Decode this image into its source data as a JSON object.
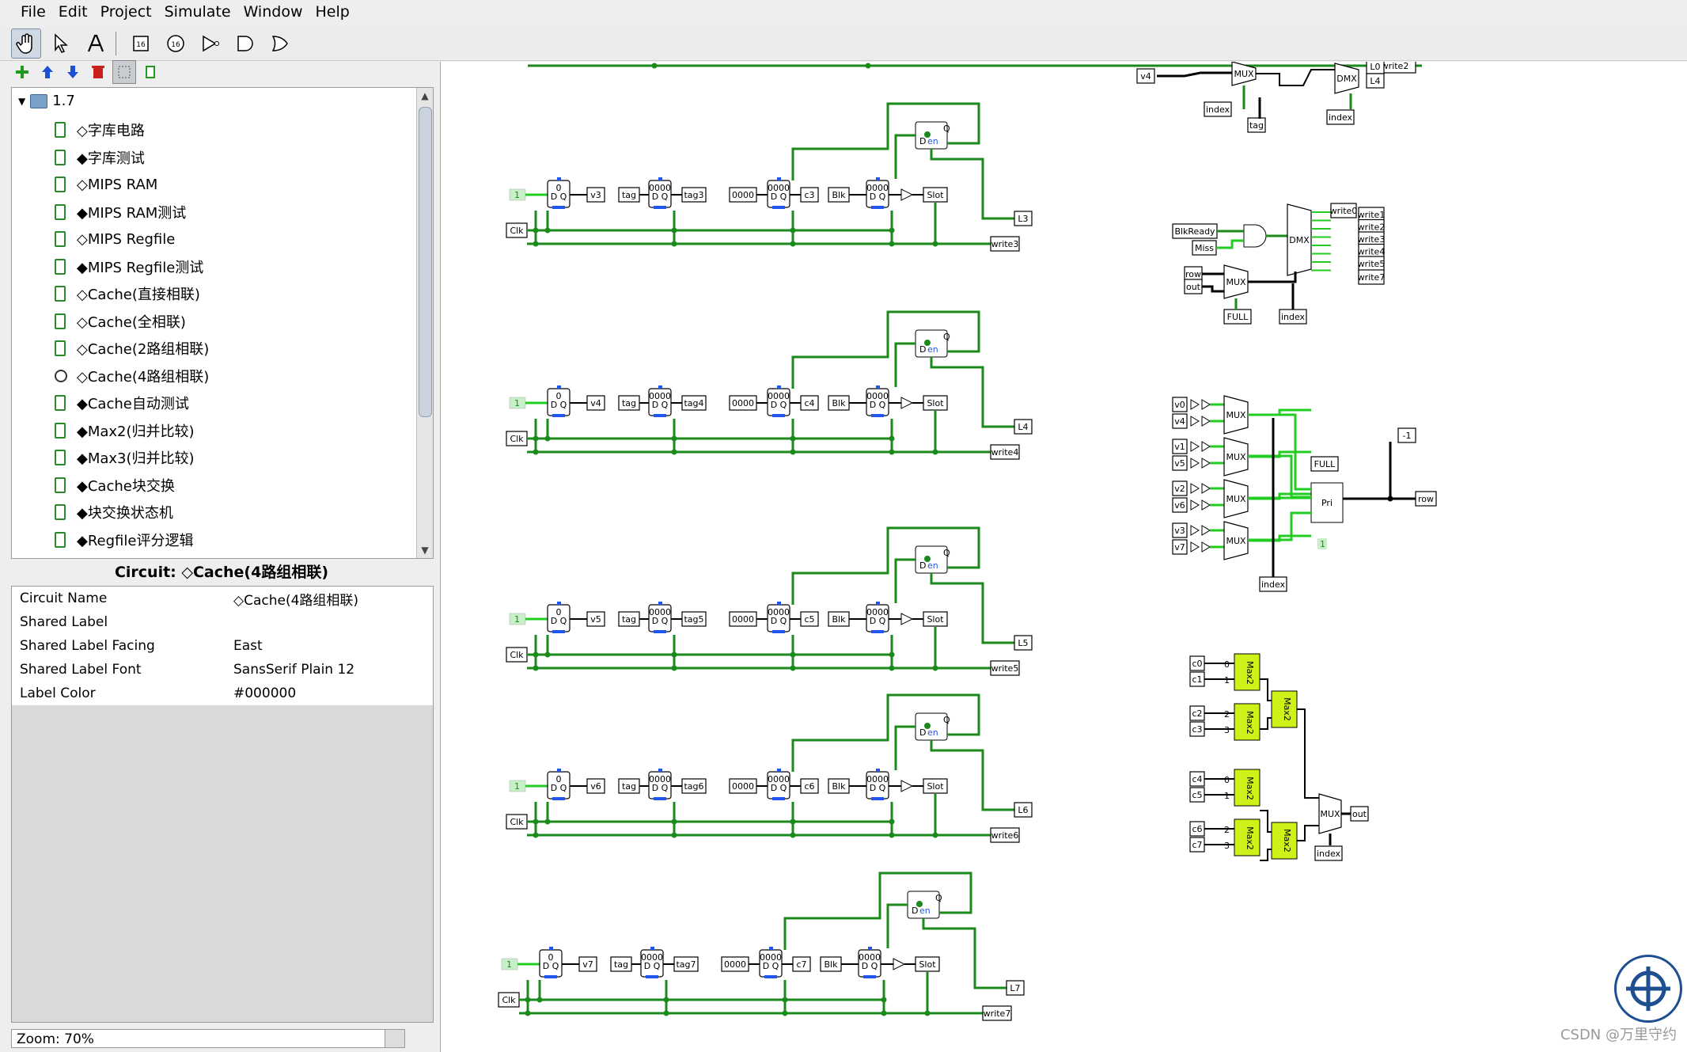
{
  "menubar": {
    "items": [
      "File",
      "Edit",
      "Project",
      "Simulate",
      "Window",
      "Help"
    ]
  },
  "toolbar": {
    "tools": [
      "hand-icon",
      "select-arrow-icon",
      "text-tool-icon",
      "input-pin-icon",
      "output-pin-icon",
      "not-gate-icon",
      "and-gate-icon",
      "or-gate-icon"
    ],
    "subtools": [
      "add-circuit-icon",
      "move-up-icon",
      "move-down-icon",
      "delete-icon",
      "layout-view-icon",
      "appearance-view-icon"
    ]
  },
  "tree": {
    "root": "1.7",
    "items": [
      "◇字库电路",
      "◆字库测试",
      "◇MIPS RAM",
      "◆MIPS RAM测试",
      "◇MIPS Regfile",
      "◆MIPS Regfile测试",
      "◇Cache(直接相联)",
      "◇Cache(全相联)",
      "◇Cache(2路组相联)",
      "◇Cache(4路组相联)",
      "◆Cache自动测试",
      "◆Max2(归并比较)",
      "◆Max3(归并比较)",
      "◆Cache块交换",
      "◆块交换状态机",
      "◆Regfile评分逻辑"
    ],
    "active_index": 9
  },
  "properties": {
    "title": "Circuit: ◇Cache(4路组相联)",
    "rows": [
      {
        "key": "Circuit Name",
        "value": "◇Cache(4路组相联)"
      },
      {
        "key": "Shared Label",
        "value": ""
      },
      {
        "key": "Shared Label Facing",
        "value": "East"
      },
      {
        "key": "Shared Label Font",
        "value": "SansSerif Plain 12"
      },
      {
        "key": "Label Color",
        "value": "#000000"
      }
    ]
  },
  "zoom": "Zoom: 70%",
  "watermark": "CSDN @万里守约",
  "circuit": {
    "rows": [
      {
        "v": "v3",
        "tag": "tag3",
        "c": "c3",
        "L": "L3",
        "write": "write3"
      },
      {
        "v": "v4",
        "tag": "tag4",
        "c": "c4",
        "L": "L4",
        "write": "write4"
      },
      {
        "v": "v5",
        "tag": "tag5",
        "c": "c5",
        "L": "L5",
        "write": "write5"
      },
      {
        "v": "v6",
        "tag": "tag6",
        "c": "c6",
        "L": "L6",
        "write": "write6"
      },
      {
        "v": "v7",
        "tag": "tag7",
        "c": "c7",
        "L": "L7",
        "write": "write7"
      }
    ],
    "common": {
      "clk": "Clk",
      "tagin": "tag",
      "zero": "0000",
      "blk": "Blk",
      "slot": "Slot",
      "one": "1",
      "dq": "D Q",
      "reg_val": "0000",
      "q": "Q",
      "d": "D",
      "en": "en"
    },
    "top": {
      "write": "write2",
      "v": "v4",
      "mux": "MUX",
      "dmx": "DMX",
      "index": "index",
      "tag": "tag",
      "L0": "L0",
      "L4": "L4"
    },
    "dmx_block": {
      "inputs": [
        "BlkReady",
        "Miss",
        "row",
        "out"
      ],
      "outputs": [
        "write0",
        "write1",
        "write2",
        "write3",
        "write4",
        "write5",
        "write6",
        "write7"
      ],
      "full": "FULL",
      "index": "index",
      "mux": "MUX",
      "dmx": "DMX"
    },
    "pri_block": {
      "v": [
        "v0",
        "v4",
        "v1",
        "v5",
        "v2",
        "v6",
        "v3",
        "v7"
      ],
      "mux": "MUX",
      "pri": "Pri",
      "full": "FULL",
      "row": "row",
      "index": "index",
      "neg": "-1",
      "one": "1"
    },
    "max_block": {
      "c": [
        "c0",
        "c1",
        "c2",
        "c3",
        "c4",
        "c5",
        "c6",
        "c7"
      ],
      "consts": [
        "0",
        "1",
        "2",
        "3",
        "0",
        "1",
        "2",
        "3"
      ],
      "max": "Max2",
      "mux": "MUX",
      "out": "out",
      "index": "index"
    }
  }
}
